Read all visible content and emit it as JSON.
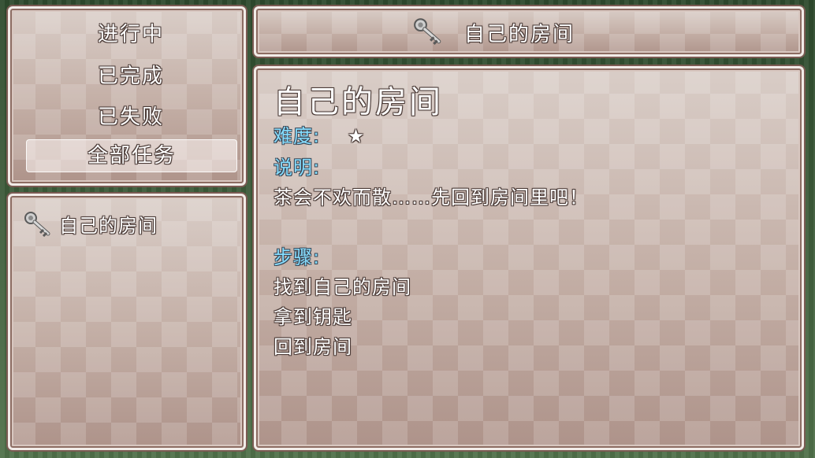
{
  "categories": [
    {
      "label": "进行中",
      "selected": false
    },
    {
      "label": "已完成",
      "selected": false
    },
    {
      "label": "已失败",
      "selected": false
    },
    {
      "label": "全部任务",
      "selected": true
    }
  ],
  "quest_list": [
    {
      "icon": "key-icon",
      "name": "自己的房间"
    }
  ],
  "header": {
    "icon": "key-icon",
    "title": "自己的房间"
  },
  "detail": {
    "title": "自己的房间",
    "difficulty_label": "难度:",
    "difficulty_stars": "★",
    "description_label": "说明:",
    "description": "茶会不欢而散……先回到房间里吧！",
    "steps_label": "步骤:",
    "steps": [
      "找到自己的房间",
      "拿到钥匙",
      "回到房间"
    ]
  }
}
